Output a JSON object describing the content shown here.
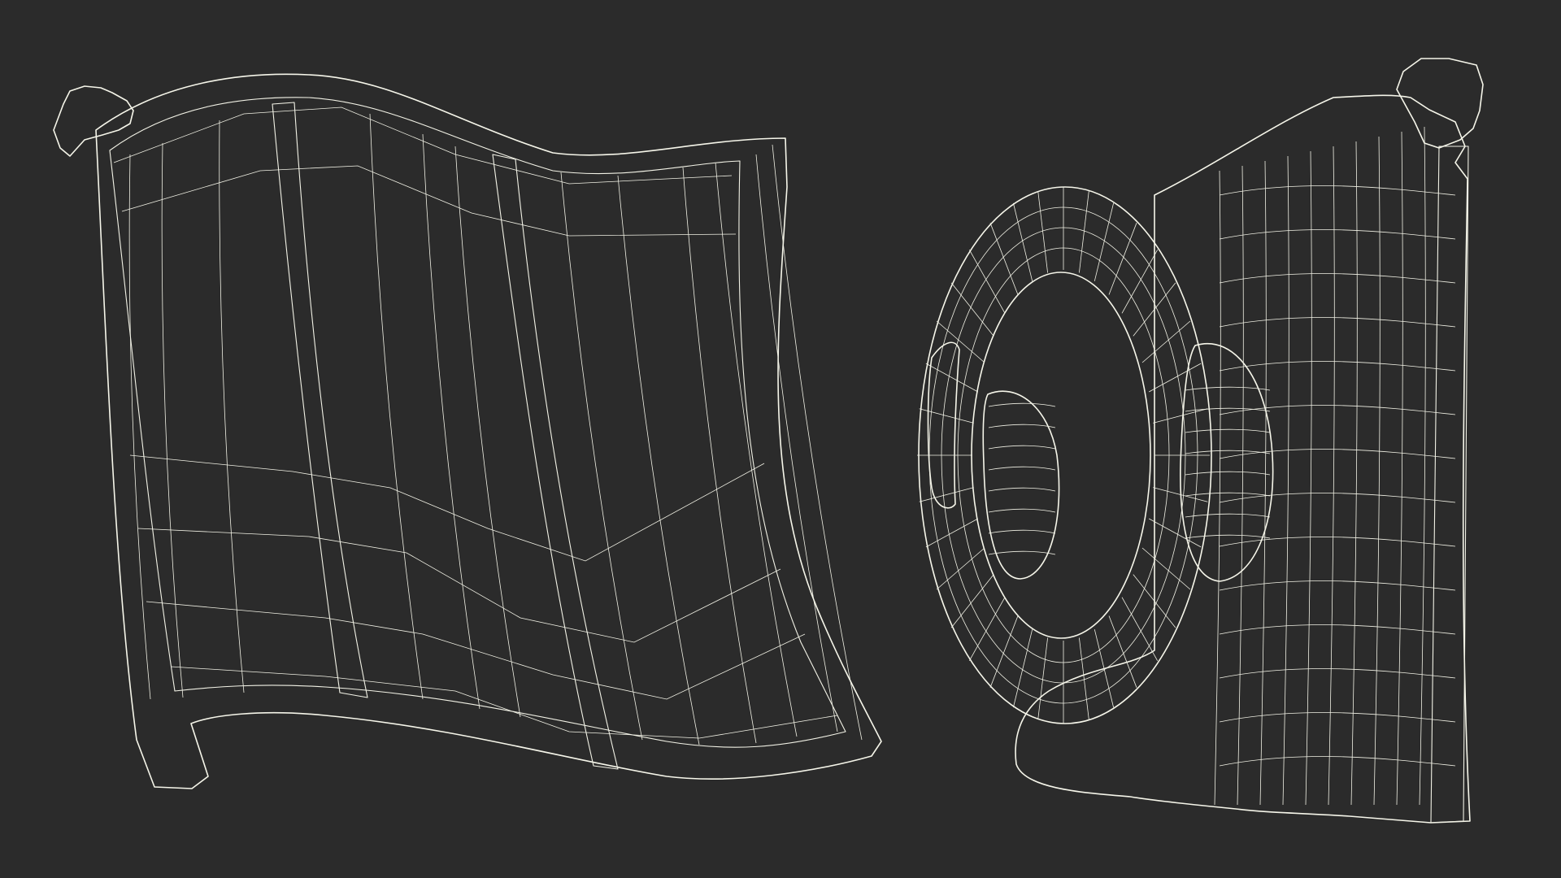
{
  "scene": {
    "background": "#2b2b2b",
    "mesh_fill": "#7b7c6f",
    "mesh_shadow": "#4e4f46",
    "wire_color": "#f2f2e6",
    "objects": [
      {
        "name": "flag-front-view",
        "view": "front",
        "render": "wireframe"
      },
      {
        "name": "flag-side-view",
        "view": "side",
        "render": "wireframe"
      }
    ]
  }
}
